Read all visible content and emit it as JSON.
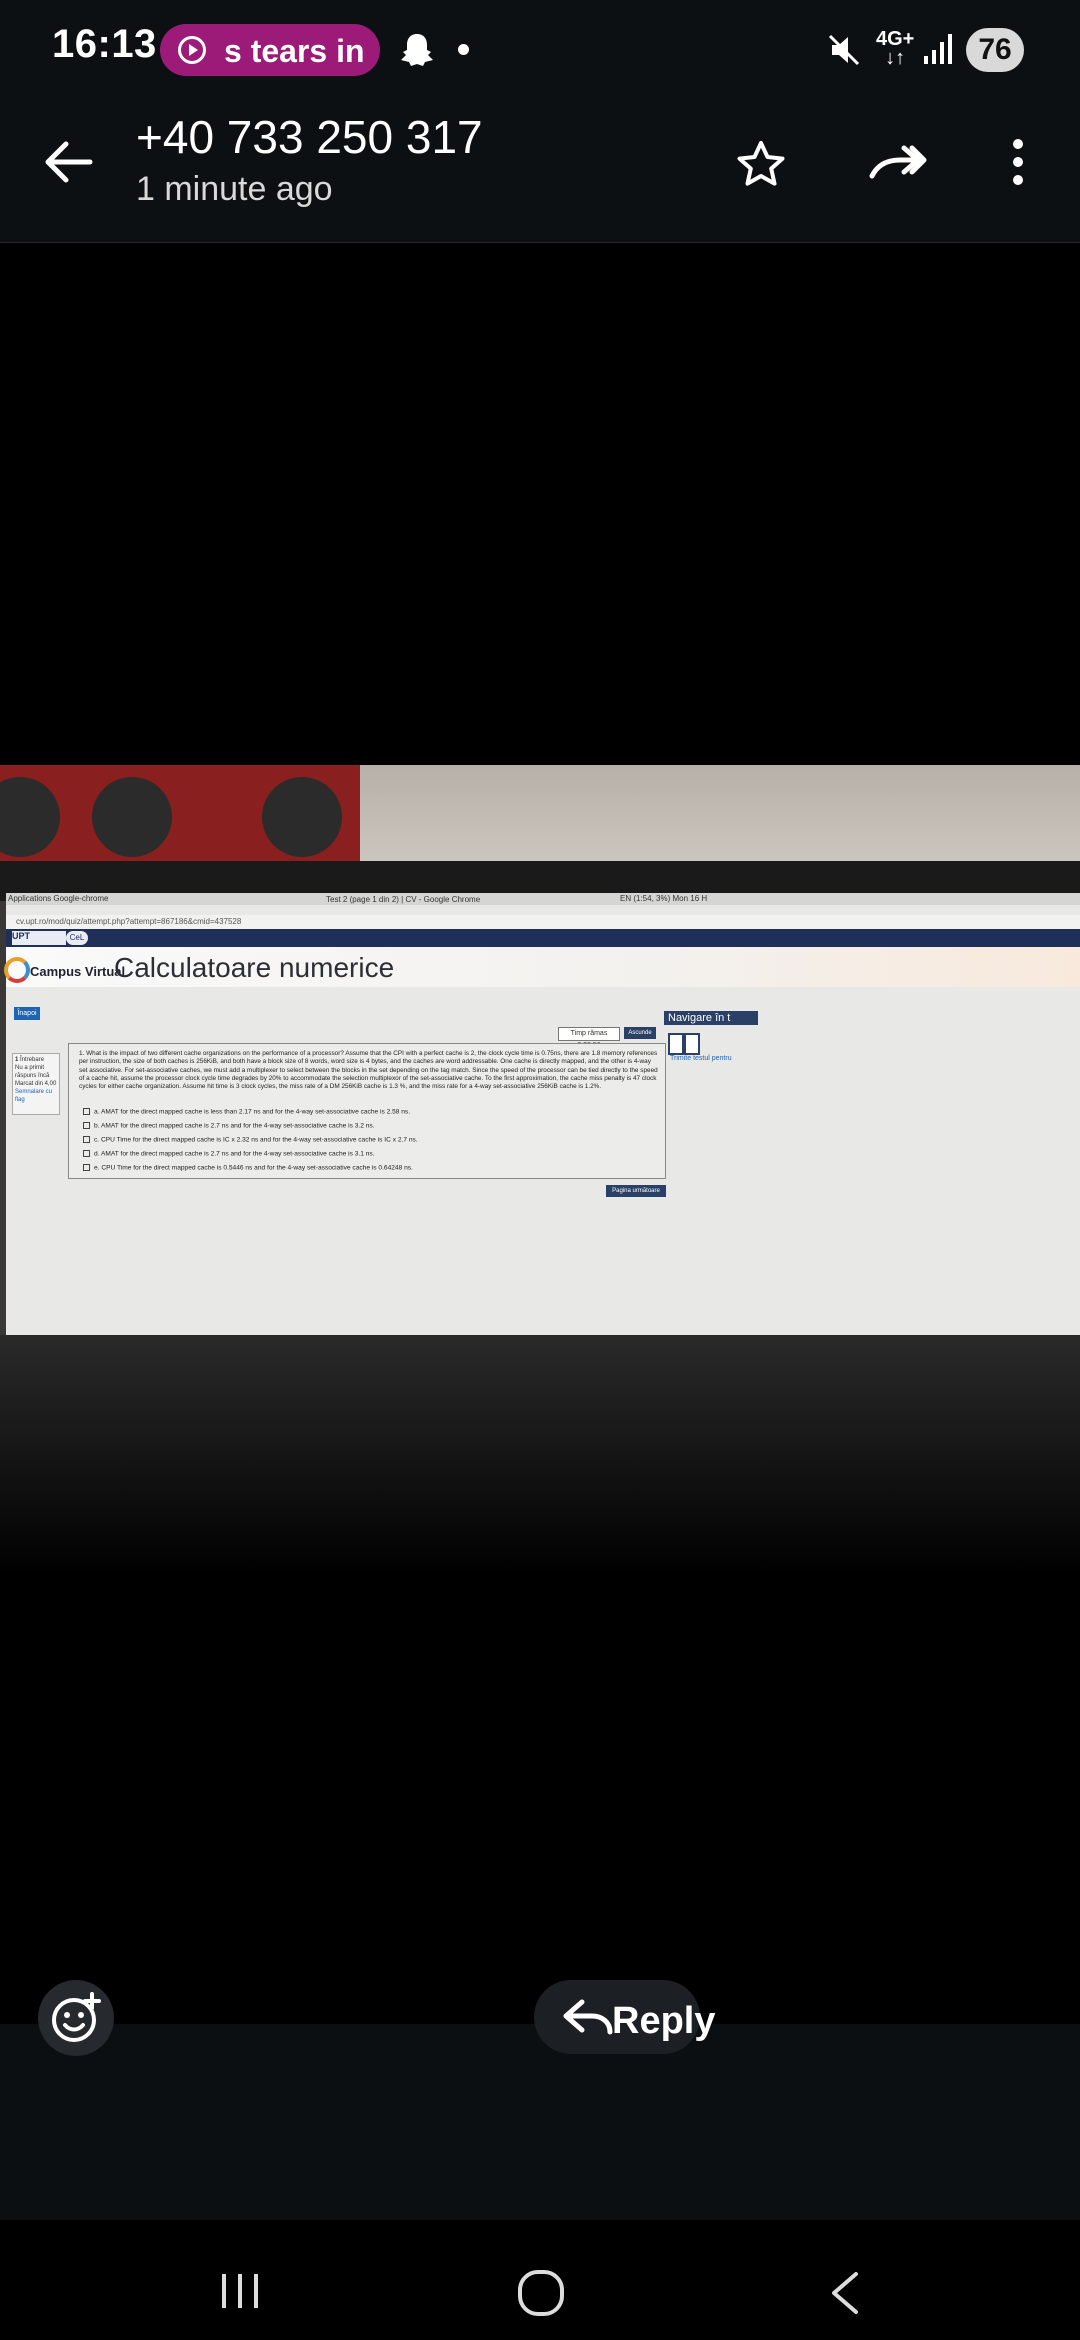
{
  "status_bar": {
    "time": "16:13",
    "media_text": "s  tears in",
    "network": "4G+",
    "battery": "76",
    "icons": [
      "play-icon",
      "snapchat-icon",
      "mute-icon",
      "signal-icon"
    ]
  },
  "header": {
    "contact": "+40 733 250 317",
    "subtitle": "1 minute ago",
    "icons": [
      "back-arrow-icon",
      "star-icon",
      "forward-icon",
      "more-icon"
    ]
  },
  "photo_screen": {
    "browser_tabs": "Applications    Google-chrome",
    "window_title": "Test 2 (page 1 din 2) | CV - Google Chrome",
    "tray": "EN  (1:54, 3%)   Mon 16 H",
    "url": "cv.upt.ro/mod/quiz/attempt.php?attempt=867186&cmid=437528",
    "logo_up": "UPT",
    "logo_cv": "CeL",
    "campus_label": "Campus Virtual",
    "course_title": "Calculatoare numerice",
    "back_button": "Înapoi",
    "timer": "Timp rămas 0:38:56",
    "hide_button": "Ascunde",
    "nav_panel_title": "Navigare în t",
    "finish_link": "Trimite testul pentru",
    "question_info": {
      "number": "1",
      "number_label": "Întrebare",
      "status": "Nu a primit răspuns încă",
      "mark": "Marcat din 4,00",
      "flag": "Semnalare cu flag"
    },
    "question_number": "1.",
    "question_text": "What is the impact of two different cache organizations on the performance of a processor? Assume that the CPI with a perfect cache is 2, the clock cycle time is 0.75ns, there are 1.8 memory references per instruction, the size of both caches is 256KiB, and both have a block size of 8 words, word size is 4 bytes, and the caches are word addressable. One cache is directly mapped, and the other is 4-way set associative. For set-associative caches, we must add a multiplexer to select between the blocks in the set depending on the tag match. Since the speed of the processor can be tied directly to the speed of a cache hit, assume the processor clock cycle time degrades by 20% to accommodate the selection multiplexor of the set-associative cache. To the first approximation, the cache miss penalty is 47 clock cycles for either cache organization. Assume hit time is 3 clock cycles, the miss rate of a DM 256KiB cache is 1.3 %, and the miss rate for a 4-way set-associative 256KiB cache is 1.2%.",
    "options": [
      {
        "letter": "a.",
        "text": "AMAT for the direct mapped cache is less than 2.17 ns and for the 4-way set-associative cache is 2.58 ns."
      },
      {
        "letter": "b.",
        "text": "AMAT for the direct mapped cache is 2.7 ns and for the 4-way set-associative cache is 3.2 ns."
      },
      {
        "letter": "c.",
        "text": "CPU Time for the direct mapped cache is IC x 2.32 ns and for the 4-way set-associative cache is IC x 2.7 ns."
      },
      {
        "letter": "d.",
        "text": "AMAT for the direct mapped cache is 2.7 ns and for the 4-way set-associative cache is 3.1 ns."
      },
      {
        "letter": "e.",
        "text": "CPU Time for the direct mapped cache is 0.5446 ns and for the 4-way set-associative cache is 0.64248 ns."
      }
    ],
    "next_button": "Pagina următoare"
  },
  "footer": {
    "reply_label": "Reply",
    "icons": [
      "emoji-add-icon",
      "reply-arrow-icon",
      "recents-icon",
      "home-icon",
      "nav-back-icon"
    ]
  },
  "colors": {
    "media_pill": "#9c1a78",
    "bar_bg": "#0d1013",
    "site_nav": "#1f2f58"
  }
}
